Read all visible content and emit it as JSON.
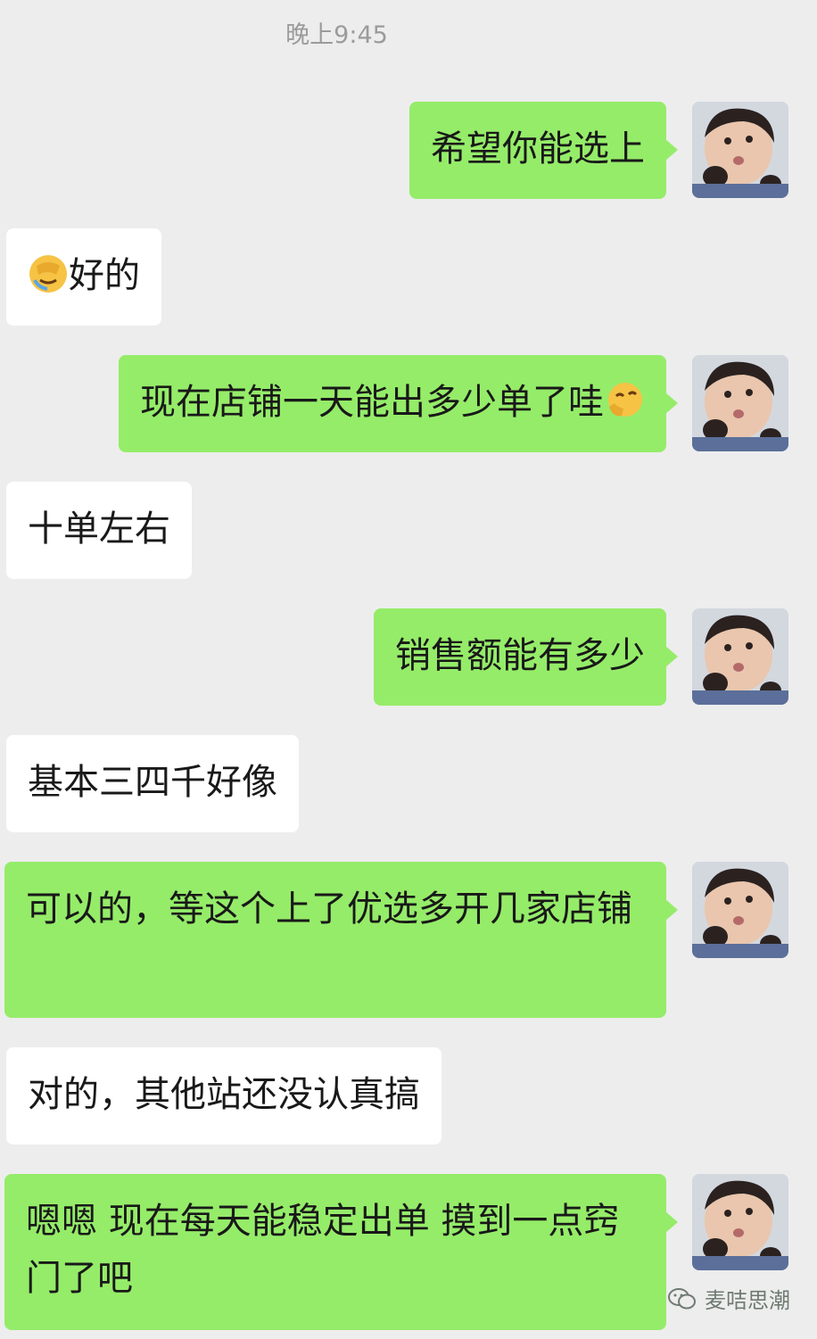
{
  "chat": {
    "timestamp": "晚上9:45",
    "messages": [
      {
        "side": "out",
        "text": "希望你能选上"
      },
      {
        "side": "in",
        "emoji": "facepalm-crying-emoji",
        "text": "好的"
      },
      {
        "side": "out",
        "text": "现在店铺一天能出多少单了哇",
        "emoji": "giggle-emoji"
      },
      {
        "side": "in",
        "text": "十单左右"
      },
      {
        "side": "out",
        "text": "销售额能有多少"
      },
      {
        "side": "in",
        "text": "基本三四千好像"
      },
      {
        "side": "out",
        "text": "可以的，等这个上了优选多开几家店铺"
      },
      {
        "side": "in",
        "text": "对的，其他站还没认真搞"
      },
      {
        "side": "out",
        "text": "嗯嗯 现在每天能稳定出单 摸到一点窍门了吧"
      }
    ]
  },
  "watermark": {
    "icon": "wechat-official-account-icon",
    "label": "麦咭思潮"
  },
  "colors": {
    "background": "#ededed",
    "outgoing_bubble": "#95ec69",
    "incoming_bubble": "#ffffff",
    "text": "#191919",
    "timestamp": "#9b9b9b"
  }
}
